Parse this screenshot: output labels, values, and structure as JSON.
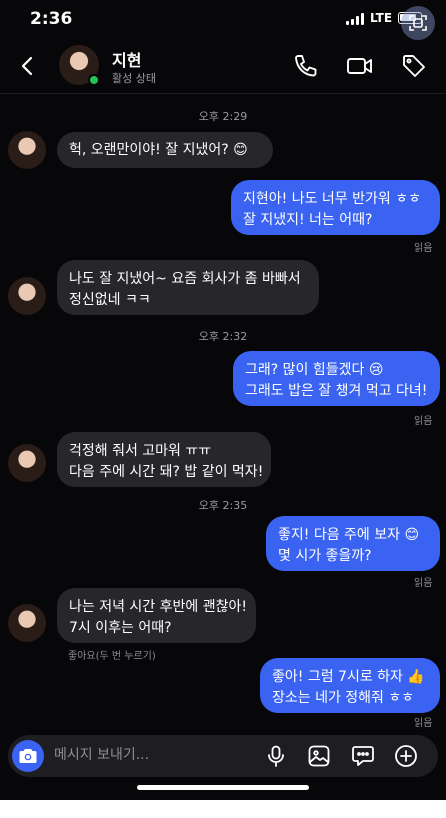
{
  "status_bar": {
    "time": "2:36",
    "network": "LTE"
  },
  "header": {
    "contact_name": "지현",
    "presence": "활성 상태",
    "icons": [
      "back-arrow-icon",
      "phone-icon",
      "video-icon",
      "tag-icon"
    ]
  },
  "messages": [
    {
      "timestamp": "오후 2:29"
    },
    {
      "direction": "in",
      "text": "헉, 오랜만이야! 잘 지냈어? 😊"
    },
    {
      "direction": "out",
      "lines": [
        "지현아! 나도 너무 반가워 ㅎㅎ",
        "잘 지냈지! 너는 어때?"
      ],
      "status": "읽음"
    },
    {
      "direction": "in",
      "lines": [
        "나도 잘 지냈어~ 요즘 회사가 좀 바빠서",
        "정신없네 ㅋㅋ"
      ]
    },
    {
      "timestamp": "오후 2:32"
    },
    {
      "direction": "out",
      "lines": [
        "그래? 많이 힘들겠다 😢",
        "그래도 밥은 잘 챙겨 먹고 다녀!"
      ],
      "status": "읽음"
    },
    {
      "direction": "in",
      "lines": [
        "걱정해 줘서 고마워 ㅠㅠ",
        "다음 주에 시간 돼? 밥 같이 먹자!"
      ]
    },
    {
      "timestamp": "오후 2:35"
    },
    {
      "direction": "out",
      "lines": [
        "좋지! 다음 주에 보자 😊",
        "몇 시가 좋을까?"
      ],
      "status": "읽음"
    },
    {
      "direction": "in",
      "lines": [
        "나는 저녁 시간 후반에 괜찮아!",
        "7시 이후는 어때?"
      ],
      "hint": "좋아요(두 번 누르기)"
    },
    {
      "direction": "out",
      "lines": [
        "좋아! 그럼 7시로 하자 👍",
        "장소는 네가 정해줘 ㅎㅎ"
      ],
      "status": "읽음"
    }
  ],
  "composer": {
    "placeholder": "메시지 보내기...",
    "icons": [
      "camera-icon",
      "microphone-icon",
      "image-icon",
      "sticker-icon",
      "plus-icon"
    ]
  },
  "colors": {
    "background": "#07070a",
    "incoming_bubble": "#26262b",
    "outgoing_bubble": "#3a63f2",
    "online": "#25c25a"
  }
}
